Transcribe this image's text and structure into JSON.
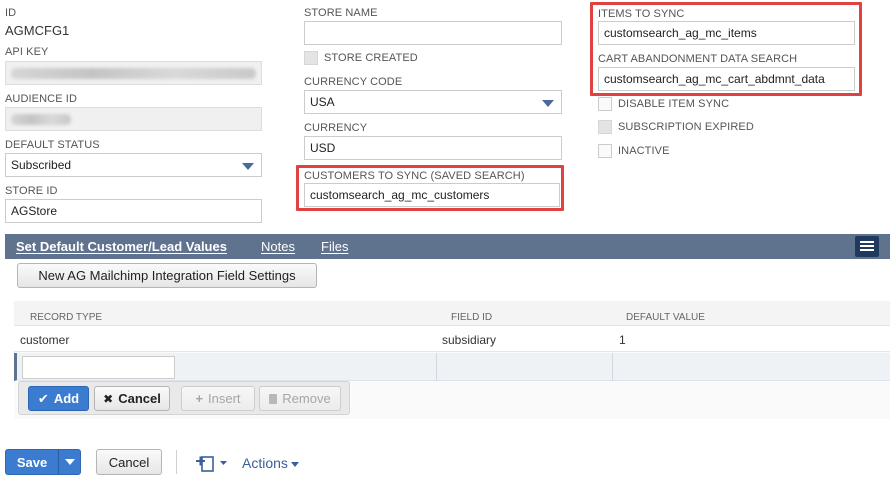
{
  "fields": {
    "id": {
      "label": "ID",
      "value": "AGMCFG1"
    },
    "api_key": {
      "label": "API KEY"
    },
    "audience_id": {
      "label": "AUDIENCE ID"
    },
    "default_status": {
      "label": "DEFAULT STATUS",
      "value": "Subscribed"
    },
    "store_id": {
      "label": "STORE ID",
      "value": "AGStore"
    },
    "store_name": {
      "label": "STORE NAME",
      "value": ""
    },
    "store_created": {
      "label": "STORE CREATED"
    },
    "currency_code": {
      "label": "CURRENCY CODE",
      "value": "USA"
    },
    "currency": {
      "label": "CURRENCY",
      "value": "USD"
    },
    "customers_to_sync": {
      "label": "CUSTOMERS TO SYNC (SAVED SEARCH)",
      "value": "customsearch_ag_mc_customers"
    },
    "items_to_sync": {
      "label": "ITEMS TO SYNC",
      "value": "customsearch_ag_mc_items"
    },
    "cart_abandonment": {
      "label": "CART ABANDONMENT DATA SEARCH",
      "value": "customsearch_ag_mc_cart_abdmnt_data"
    },
    "disable_item_sync": {
      "label": "DISABLE ITEM SYNC"
    },
    "subscription_expired": {
      "label": "SUBSCRIPTION EXPIRED"
    },
    "inactive": {
      "label": "INACTIVE"
    }
  },
  "tabs": [
    "Set Default Customer/Lead Values",
    "Notes",
    "Files"
  ],
  "sublist": {
    "new_button": "New AG Mailchimp Integration Field Settings",
    "columns": [
      "RECORD TYPE",
      "FIELD ID",
      "DEFAULT VALUE"
    ],
    "rows": [
      {
        "record_type": "customer",
        "field_id": "subsidiary",
        "default_value": "1"
      }
    ],
    "buttons": {
      "add": "Add",
      "cancel": "Cancel",
      "insert": "Insert",
      "remove": "Remove"
    }
  },
  "footer": {
    "save": "Save",
    "cancel": "Cancel",
    "actions": "Actions"
  },
  "colors": {
    "highlight": "#e04141",
    "tab_bar": "#5f738f",
    "primary": "#3b7cd1"
  },
  "icons": [
    "chevron-down-icon",
    "checkmark-icon",
    "x-icon",
    "plus-icon",
    "trash-icon",
    "menu-icon",
    "new-record-icon"
  ]
}
